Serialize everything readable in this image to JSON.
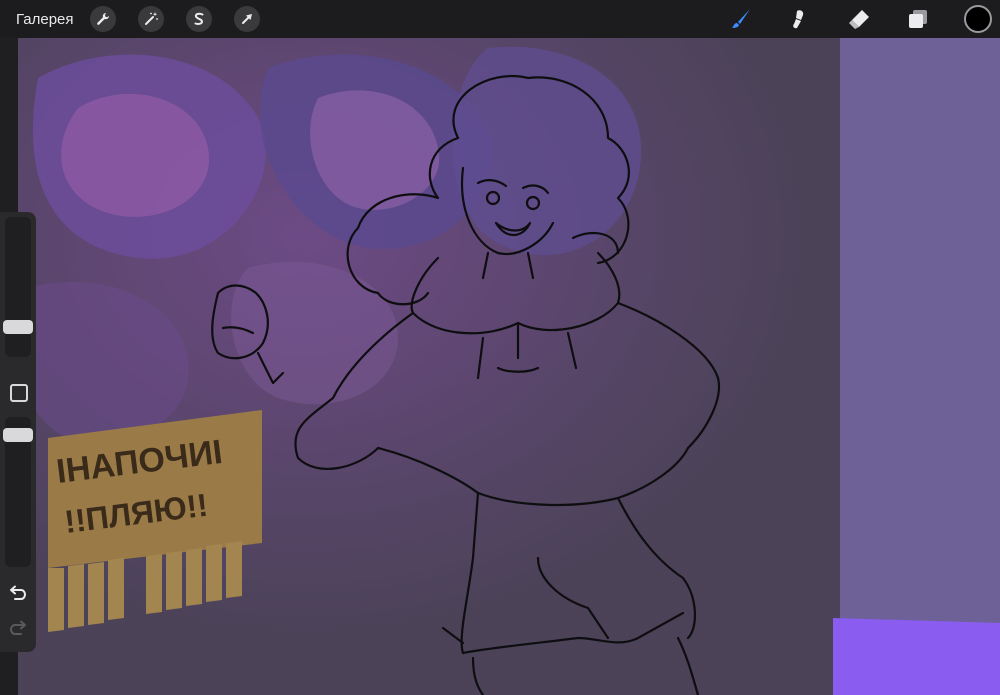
{
  "app": {
    "gallery_label": "Галерея"
  },
  "toolbar_left": [
    {
      "name": "actions",
      "icon": "wrench-icon"
    },
    {
      "name": "adjustments",
      "icon": "magic-wand-icon"
    },
    {
      "name": "selection",
      "icon": "selection-s-icon"
    },
    {
      "name": "transform",
      "icon": "arrow-cursor-icon"
    }
  ],
  "toolbar_right": [
    {
      "name": "brush",
      "icon": "brush-icon",
      "active": true
    },
    {
      "name": "smudge",
      "icon": "smudge-icon",
      "active": false
    },
    {
      "name": "eraser",
      "icon": "eraser-icon",
      "active": false
    },
    {
      "name": "layers",
      "icon": "layers-icon",
      "active": false
    }
  ],
  "current_color": "#000000",
  "accent_color": "#3b8dff",
  "sidebar": {
    "brush_size_level": 0.2,
    "opacity_level": 0.95
  },
  "poster": {
    "line1": "ІНАПОЧИІ",
    "line2": "!!ПЛЯЮ!!"
  }
}
